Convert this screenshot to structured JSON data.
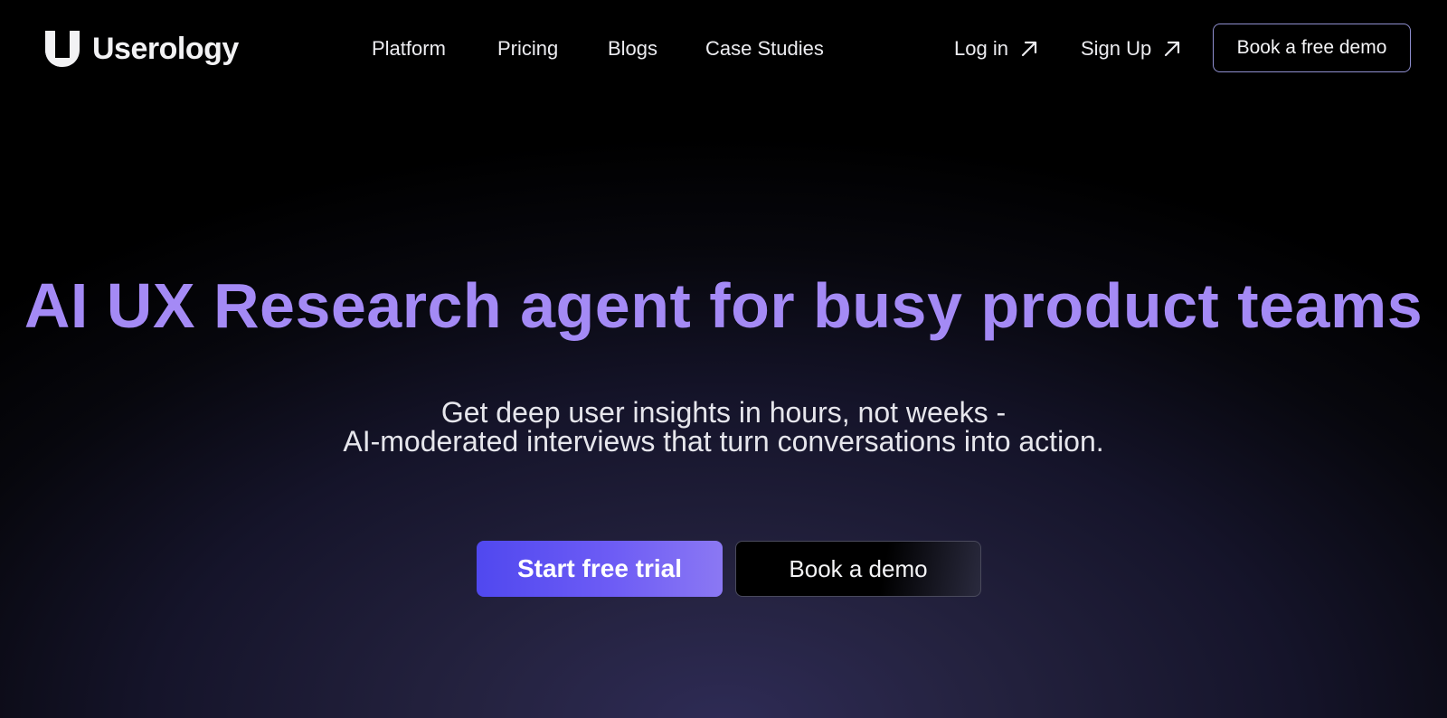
{
  "brand": {
    "name": "Userology",
    "logo_icon": "userology-u-logo-icon"
  },
  "nav": {
    "links": [
      {
        "label": "Platform"
      },
      {
        "label": "Pricing"
      },
      {
        "label": "Blogs"
      },
      {
        "label": "Case Studies"
      }
    ],
    "login_label": "Log in",
    "signup_label": "Sign Up",
    "external_icon": "arrow-up-right-icon",
    "demo_label": "Book a free demo"
  },
  "hero": {
    "title": "AI UX Research agent for busy product teams",
    "subtitle_line1": "Get deep user insights in hours, not weeks -",
    "subtitle_line2": "AI-moderated interviews that turn conversations into action.",
    "primary_cta": "Start free trial",
    "secondary_cta": "Book a demo"
  },
  "colors": {
    "background": "#000000",
    "accent_purple": "#a48af5",
    "primary_button": "#5b4ff0",
    "outline_border": "#8f8fd0"
  }
}
